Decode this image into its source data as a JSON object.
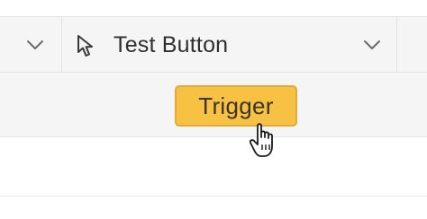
{
  "header": {
    "column_title": "Test Button",
    "column_icon": "cursor-arrow-icon",
    "prev_column_icon": "chevron-down-icon",
    "column_menu_icon": "chevron-down-icon"
  },
  "row": {
    "button_label": "Trigger"
  },
  "colors": {
    "button_fill": "#f7c244",
    "button_border": "#e4a936",
    "header_bg": "#f5f5f5"
  },
  "pointer": "hand-pointer-icon"
}
